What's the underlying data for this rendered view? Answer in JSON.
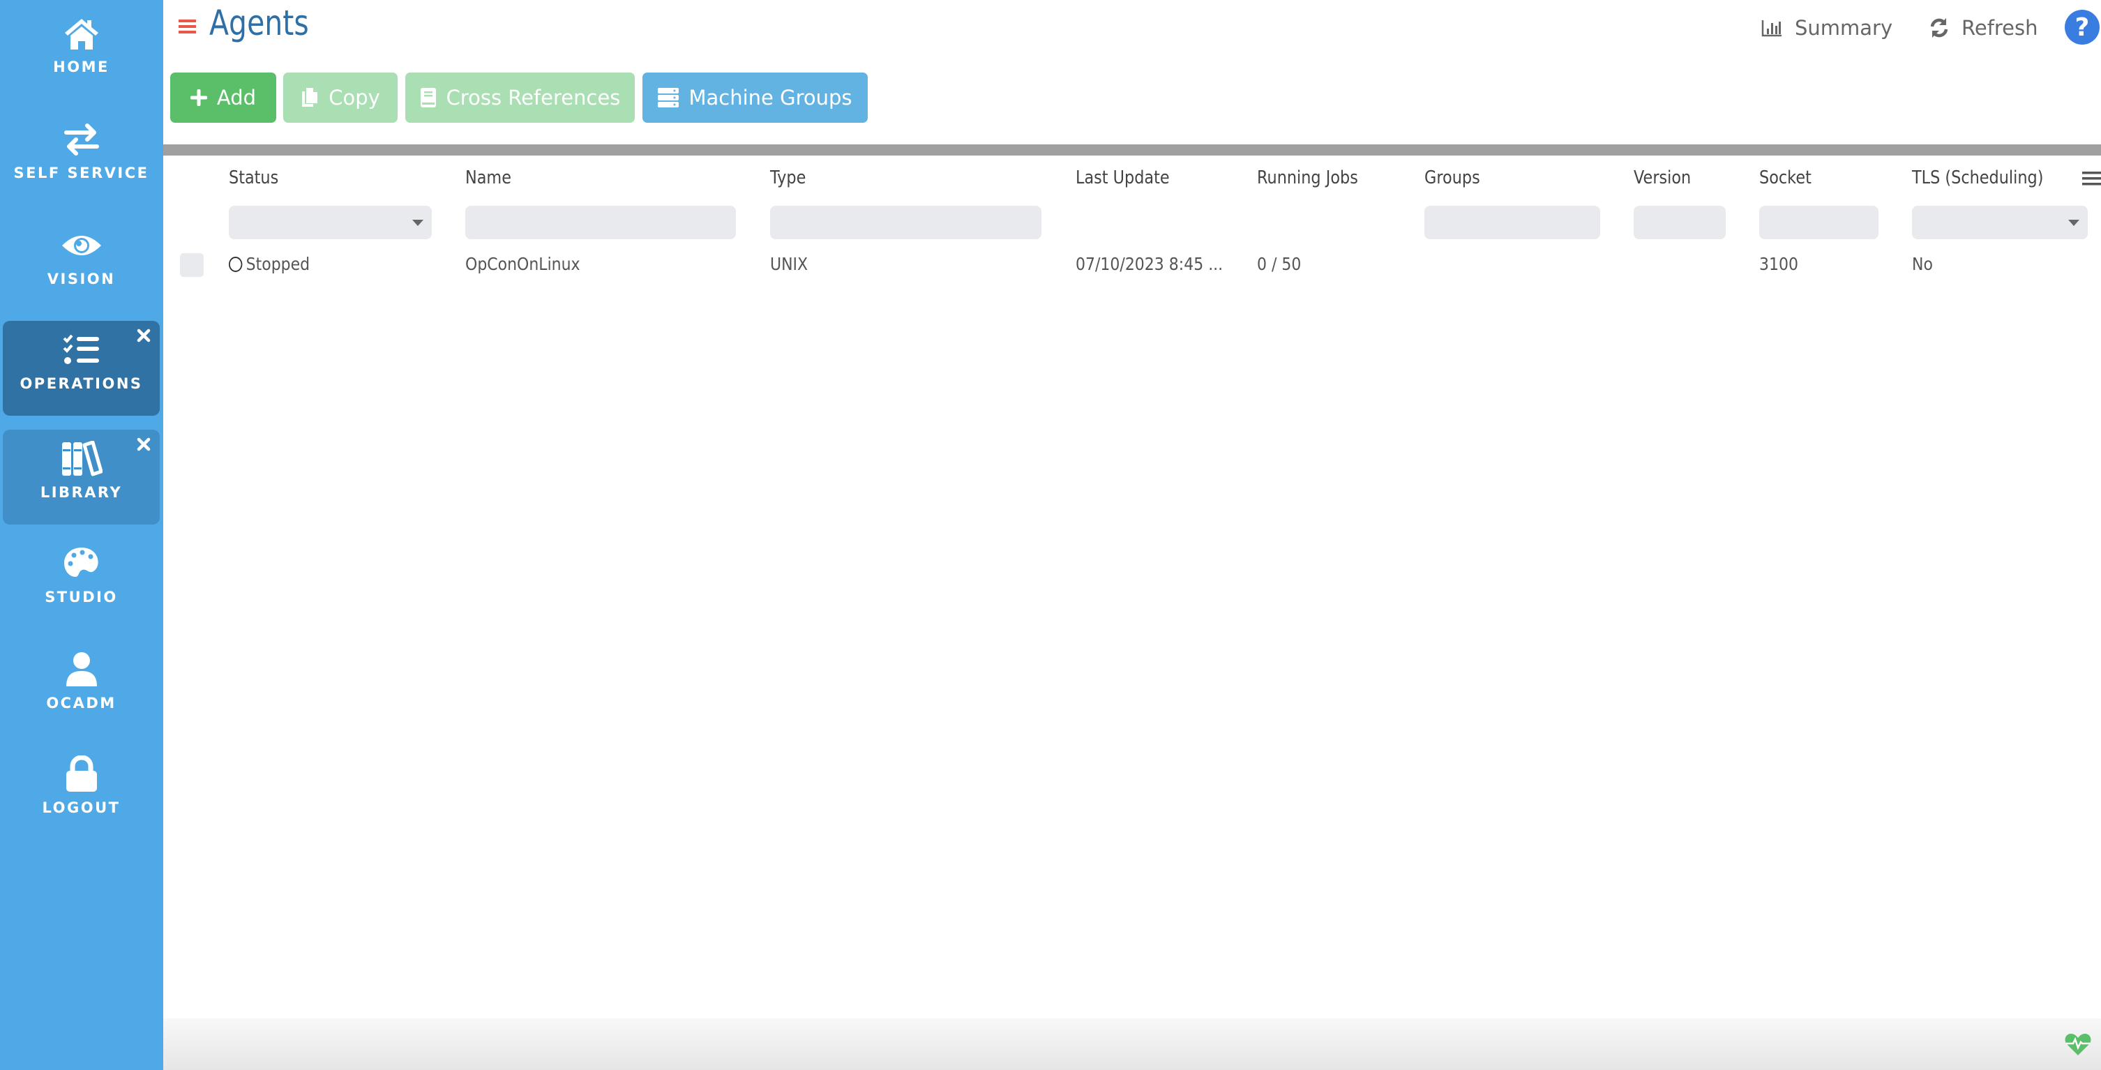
{
  "sidebar": {
    "items": [
      {
        "label": "HOME",
        "icon": "home-icon",
        "state": "normal"
      },
      {
        "label": "SELF SERVICE",
        "icon": "exchange-icon",
        "state": "normal"
      },
      {
        "label": "VISION",
        "icon": "eye-icon",
        "state": "normal"
      },
      {
        "label": "OPERATIONS",
        "icon": "tasks-icon",
        "state": "active",
        "closable": true
      },
      {
        "label": "LIBRARY",
        "icon": "books-icon",
        "state": "open",
        "closable": true
      },
      {
        "label": "STUDIO",
        "icon": "palette-icon",
        "state": "normal"
      },
      {
        "label": "OCADM",
        "icon": "user-icon",
        "state": "normal"
      },
      {
        "label": "LOGOUT",
        "icon": "lock-icon",
        "state": "normal"
      }
    ]
  },
  "header": {
    "title": "Agents",
    "summary_label": "Summary",
    "refresh_label": "Refresh",
    "help_label": "?"
  },
  "toolbar": {
    "add_label": "Add",
    "copy_label": "Copy",
    "cross_references_label": "Cross References",
    "machine_groups_label": "Machine Groups"
  },
  "grid": {
    "columns": [
      {
        "key": "status",
        "label": "Status",
        "filter": "select"
      },
      {
        "key": "name",
        "label": "Name",
        "filter": "text"
      },
      {
        "key": "type",
        "label": "Type",
        "filter": "text"
      },
      {
        "key": "last_update",
        "label": "Last Update",
        "filter": "none"
      },
      {
        "key": "running_jobs",
        "label": "Running Jobs",
        "filter": "none"
      },
      {
        "key": "groups",
        "label": "Groups",
        "filter": "text"
      },
      {
        "key": "version",
        "label": "Version",
        "filter": "text"
      },
      {
        "key": "socket",
        "label": "Socket",
        "filter": "text"
      },
      {
        "key": "tls",
        "label": "TLS (Scheduling)",
        "filter": "select"
      }
    ],
    "filters": {
      "status": "",
      "name": "",
      "type": "",
      "groups": "",
      "version": "",
      "socket": "",
      "tls": ""
    },
    "rows": [
      {
        "selected": false,
        "status": "Stopped",
        "name": "OpConOnLinux",
        "type": "UNIX",
        "last_update": "07/10/2023 8:45 ...",
        "running_jobs": "0 / 50",
        "groups": "",
        "version": "",
        "socket": "3100",
        "tls": "No"
      }
    ]
  },
  "colors": {
    "sidebar": "#4fa9e6",
    "sidebar_active": "#3172a4",
    "sidebar_open": "#408fc8",
    "title": "#2e6fa7",
    "add": "#5bbf6a",
    "disabled_green": "#aadfb4",
    "machine_groups": "#62b2e2",
    "help": "#3a7de0",
    "health": "#5bbf6a",
    "hamburger": "#e8574a"
  }
}
